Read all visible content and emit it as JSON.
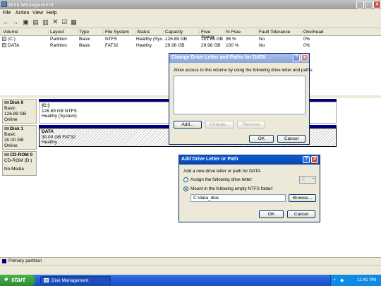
{
  "window": {
    "title": "Disk Management",
    "controls": [
      "_",
      "□",
      "×"
    ]
  },
  "menu": [
    "File",
    "Action",
    "View",
    "Help"
  ],
  "toolbar": {
    "icons": [
      "back-icon",
      "forward-icon",
      "up-icon",
      "properties-icon",
      "help-icon",
      "delete-icon",
      "check-icon",
      "export-icon"
    ]
  },
  "list": {
    "columns": [
      "Volume",
      "Layout",
      "Type",
      "File System",
      "Status",
      "Capacity",
      "Free Space",
      "% Free",
      "Fault Tolerance",
      "Overhead"
    ],
    "rows": [
      [
        "(C:)",
        "Partition",
        "Basic",
        "NTFS",
        "Healthy (Sys...",
        "126.89 GB",
        "121.66 GB",
        "96 %",
        "No",
        "0%"
      ],
      [
        "DATA",
        "Partition",
        "Basic",
        "FAT32",
        "Healthy",
        "29.98 GB",
        "29.98 GB",
        "100 %",
        "No",
        "0%"
      ]
    ]
  },
  "disks": [
    {
      "name": "Disk 0",
      "type": "Basic",
      "size": "126.89 GB",
      "state": "Online",
      "partition": {
        "label": "(C:)",
        "detail": "126.89 GB NTFS",
        "status": "Healthy (System)"
      }
    },
    {
      "name": "Disk 1",
      "type": "Basic",
      "size": "30.00 GB",
      "state": "Online",
      "partition": {
        "label": "DATA",
        "detail": "30.00 GB FAT32",
        "status": "Healthy"
      }
    },
    {
      "name": "CD-ROM 0",
      "type": "CD-ROM (D:)",
      "size": "",
      "state": "No Media"
    }
  ],
  "legend": {
    "label": "Primary partition",
    "color": "#00007f"
  },
  "dialog_paths": {
    "title": "Change Drive Letter and Paths for DATA",
    "description": "Allow access to this volume by using the following drive letter and paths:",
    "add": "Add...",
    "change": "Change...",
    "remove": "Remove",
    "ok": "OK",
    "cancel": "Cancel"
  },
  "dialog_add": {
    "title": "Add Drive Letter or Path",
    "description": "Add a new drive letter or path for DATA.",
    "option_letter": "Assign the following drive letter:",
    "letter_value": "E",
    "option_folder": "Mount in the following empty NTFS folder:",
    "folder_value": "C:\\data_disk",
    "browse": "Browse...",
    "ok": "OK",
    "cancel": "Cancel"
  },
  "taskbar": {
    "start": "start",
    "task": "Disk Management",
    "clock": "11:41 PM"
  }
}
